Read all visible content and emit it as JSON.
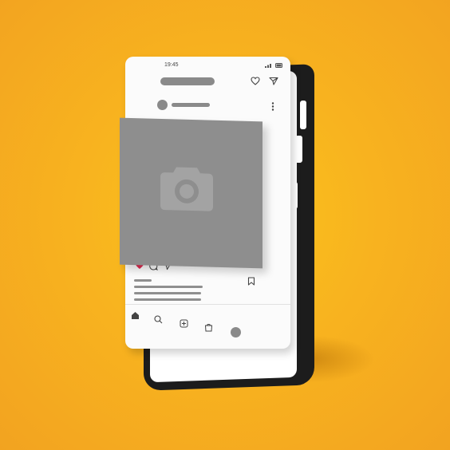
{
  "status_bar": {
    "time": "19:45"
  },
  "icons": {
    "header": [
      "heart-icon",
      "send-icon"
    ],
    "post_menu": "more-vertical-icon",
    "photo": "camera-icon",
    "actions": [
      "like-heart-icon",
      "comment-icon",
      "share-icon",
      "bookmark-icon"
    ],
    "bottom_nav": [
      "home-icon",
      "search-icon",
      "add-post-icon",
      "shop-icon",
      "profile-avatar"
    ]
  },
  "colors": {
    "background": "#f8b31f",
    "placeholder": "#8e8e8e",
    "like": "#e0284f",
    "phone_frame": "#1c1c1c"
  },
  "post": {
    "liked": true
  }
}
